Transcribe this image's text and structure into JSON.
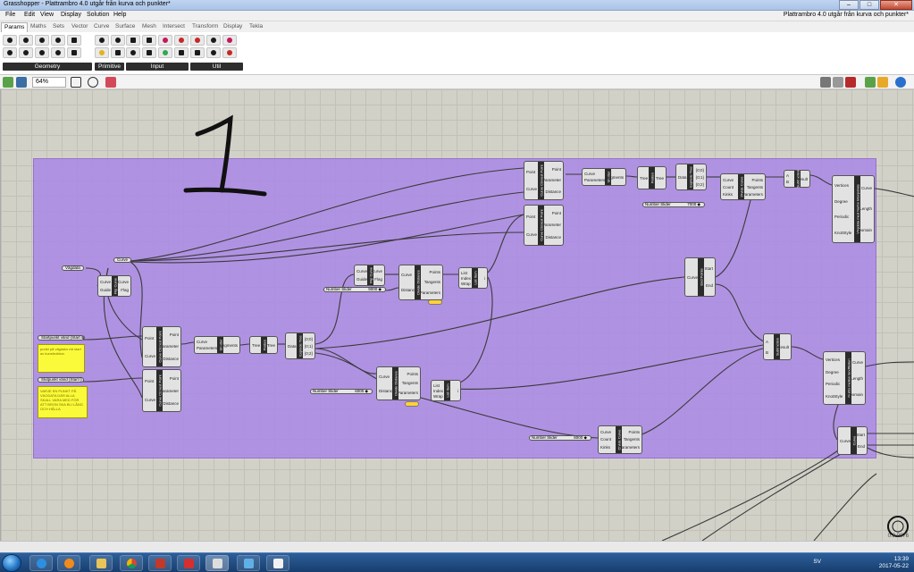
{
  "window": {
    "title": "Grasshopper - Plattrambro 4.0 utgår från kurva och punkter*",
    "document_title": "Plattrambro 4.0 utgår från kurva och punkter*"
  },
  "menu": [
    "File",
    "Edit",
    "View",
    "Display",
    "Solution",
    "Help"
  ],
  "tabs": [
    "Params",
    "Maths",
    "Sets",
    "Vector",
    "Curve",
    "Surface",
    "Mesh",
    "Intersect",
    "Transform",
    "Display",
    "Tekla"
  ],
  "ribbon": {
    "groups": [
      "Geometry",
      "Primitive",
      "Input",
      "Util"
    ]
  },
  "toolbar": {
    "zoom": "64%"
  },
  "canvas": {
    "annotation_number": "1",
    "coordinates": "0.9.0076",
    "params": {
      "vagdata": "Vägdata",
      "curve": "Curve",
      "startpunkt": "Startpunkt vänd (Start s)",
      "slutpunkt": "Slutpunkt vänd (Start l)"
    },
    "panels": {
      "p1": "punkt på vägdata vid start av konstruktion",
      "p2": "VARJE EN PUNKT PÅ VÄGDATA DÄR ALLA SKALL VARA MED FÖR ATT BRON SKA BLI LÅNG OCH HÅLLA"
    },
    "sliders": {
      "s1": {
        "label": "Number Slider",
        "value": "9000 ◆"
      },
      "s2": {
        "label": "Number Slider",
        "value": "6000 ◆"
      },
      "s3": {
        "label": "Number Slider",
        "value": "7000 ◆"
      },
      "s4": {
        "label": "Number Slider",
        "value": "8000 ◆"
      }
    },
    "components": {
      "curve_closest_top": {
        "name": "Curve Closest Point",
        "inputs": [
          "Point",
          "Curve"
        ],
        "outputs": [
          "Point",
          "Parameter",
          "Distance"
        ]
      },
      "curve_closest_mid": {
        "name": "Curve Closest Point",
        "inputs": [
          "Point",
          "Curve"
        ],
        "outputs": [
          "Point",
          "Parameter",
          "Distance"
        ]
      },
      "curve_closest_a": {
        "name": "Curve Closest Point",
        "inputs": [
          "Point",
          "Curve"
        ],
        "outputs": [
          "Point",
          "Parameter",
          "Distance"
        ]
      },
      "curve_closest_b": {
        "name": "Curve Closest Point",
        "inputs": [
          "Point",
          "Curve"
        ],
        "outputs": [
          "Point",
          "Parameter",
          "Distance"
        ]
      },
      "shatter": {
        "name": "Shatter",
        "inputs": [
          "Curve",
          "Parameters"
        ],
        "outputs": [
          "Segments"
        ]
      },
      "shatter2": {
        "name": "Shatter",
        "inputs": [
          "Curve",
          "Parameters"
        ],
        "outputs": [
          "Segments"
        ]
      },
      "flip": {
        "name": "Flip Curve",
        "inputs": [
          "Curve",
          "Guide"
        ],
        "outputs": [
          "Curve",
          "Flag"
        ]
      },
      "flip2": {
        "name": "Flip Curve",
        "inputs": [
          "Curve",
          "Guide"
        ],
        "outputs": [
          "Curve",
          "Flag"
        ]
      },
      "divide": {
        "name": "Divide Distance",
        "inputs": [
          "Curve",
          "Distance"
        ],
        "outputs": [
          "Points",
          "Tangents",
          "Parameters"
        ]
      },
      "divide2": {
        "name": "Divide Distance",
        "inputs": [
          "Curve",
          "Distance"
        ],
        "outputs": [
          "Points",
          "Tangents",
          "Parameters"
        ]
      },
      "divide_curve": {
        "name": "Divide Curve",
        "inputs": [
          "Curve",
          "Count",
          "Kinks"
        ],
        "outputs": [
          "Points",
          "Tangents",
          "Parameters"
        ]
      },
      "divide_curve2": {
        "name": "Divide Curve",
        "inputs": [
          "Curve",
          "Count",
          "Kinks"
        ],
        "outputs": [
          "Points",
          "Tangents",
          "Parameters"
        ]
      },
      "list_item": {
        "name": "List Item",
        "inputs": [
          "List",
          "Index",
          "Wrap"
        ],
        "outputs": [
          "i"
        ]
      },
      "list_item2": {
        "name": "List Item",
        "inputs": [
          "List",
          "Index",
          "Wrap"
        ],
        "outputs": [
          "i"
        ]
      },
      "flatten": {
        "name": "Flatten",
        "inputs": [
          "Tree"
        ],
        "outputs": [
          "Tree"
        ]
      },
      "flatten2": {
        "name": "Flatten",
        "inputs": [
          "Tree"
        ],
        "outputs": [
          "Tree"
        ]
      },
      "explode_tree": {
        "name": "Explode Tree",
        "inputs": [
          "Data"
        ],
        "outputs": [
          "{0;0}",
          "{0;1}",
          "{0;2}"
        ]
      },
      "explode_tree2": {
        "name": "Explode Tree",
        "inputs": [
          "Data"
        ],
        "outputs": [
          "{0;0}",
          "{0;1}",
          "{0;2}"
        ]
      },
      "subtraction": {
        "name": "Subtraction",
        "inputs": [
          "A",
          "B"
        ],
        "outputs": [
          "Result"
        ]
      },
      "subtraction2": {
        "name": "Subtraction",
        "inputs": [
          "A",
          "B"
        ],
        "outputs": [
          "Result"
        ]
      },
      "endpoints": {
        "name": "End Points",
        "inputs": [
          "Curve"
        ],
        "outputs": [
          "Start",
          "End"
        ]
      },
      "endpoints2": {
        "name": "End Points",
        "inputs": [
          "Curve"
        ],
        "outputs": [
          "Start",
          "End"
        ]
      },
      "nurbs_top": {
        "name": "Vägdata med Nurbs Interpolate",
        "inputs": [
          "Vertices",
          "Degree",
          "Periodic",
          "KnotStyle"
        ],
        "outputs": [
          "Curve",
          "Length",
          "Domain"
        ]
      },
      "nurbs_bottom": {
        "name": "Nurbs mellan landfästen",
        "inputs": [
          "Vertices",
          "Degree",
          "Periodic",
          "KnotStyle"
        ],
        "outputs": [
          "Curve",
          "Length",
          "Domain"
        ]
      },
      "offset": {
        "name": "Curve",
        "inputs": [
          "Curve"
        ],
        "outputs": [
          "Start",
          "End"
        ]
      }
    }
  },
  "taskbar": {
    "language": "SV",
    "time": "13:39",
    "date": "2017-05-22"
  }
}
